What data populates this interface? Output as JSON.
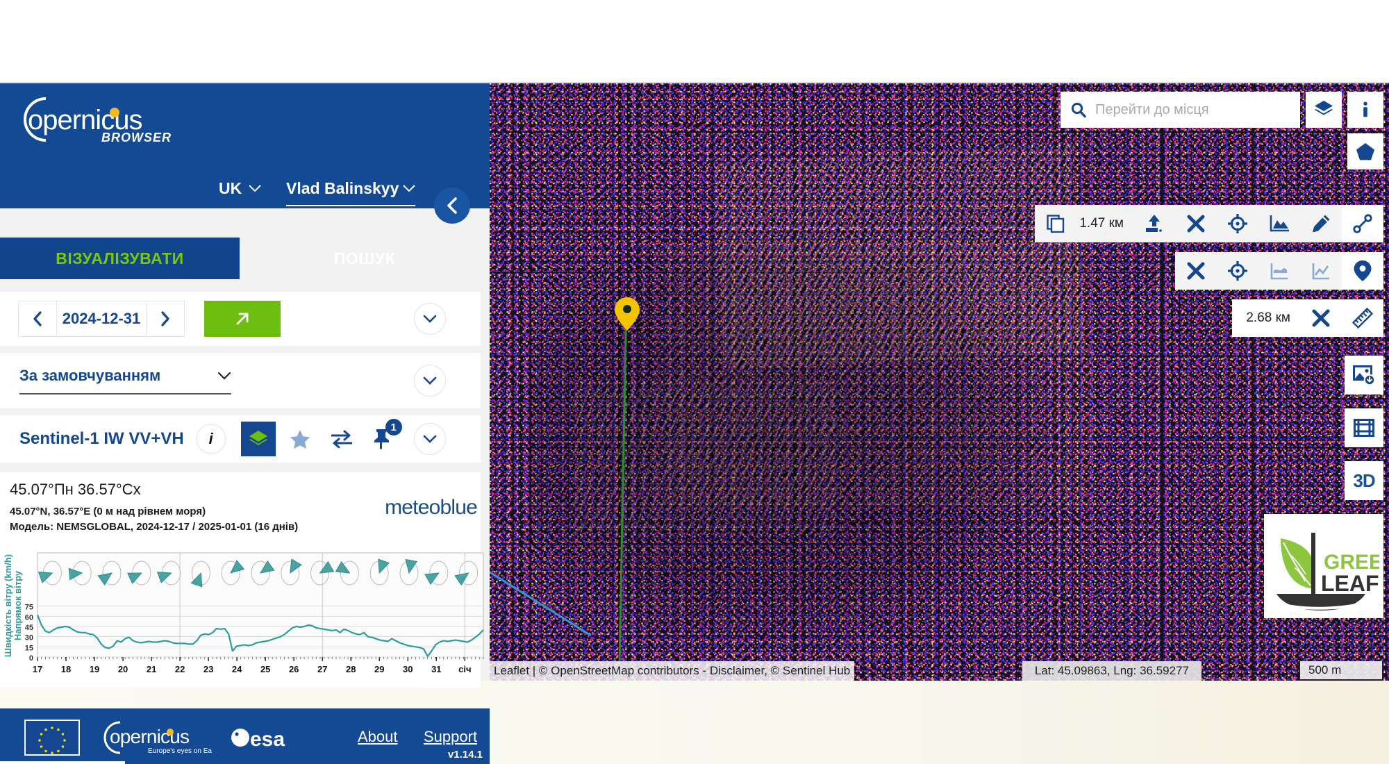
{
  "header": {
    "brand": "Copernicus",
    "brand_sub": "BROWSER",
    "language": "UK",
    "user": "Vlad Balinskyy",
    "collapse_icon": "chevron-left-icon"
  },
  "tabs": [
    {
      "label": "ВІЗУАЛІЗУВАТИ",
      "active": true
    },
    {
      "label": "ПОШУК",
      "active": false
    }
  ],
  "date_panel": {
    "prev_icon": "chevron-left-icon",
    "next_icon": "chevron-right-icon",
    "value": "2024-12-31",
    "go_icon": "arrow-up-right-icon",
    "expand_icon": "chevron-down-icon"
  },
  "preset_panel": {
    "value": "За замовчуванням",
    "dropdown_icon": "chevron-down-icon",
    "expand_icon": "chevron-down-icon"
  },
  "layer_panel": {
    "title": "Sentinel-1 IW VV+VH",
    "info_label": "i",
    "icons": [
      "layers-icon",
      "star-icon",
      "compare-icon",
      "pin-icon"
    ],
    "pin_badge": "1",
    "expand_icon": "chevron-down-icon"
  },
  "meteoblue": {
    "coordinates": "45.07°Пн 36.57°Сх",
    "subtitle_1": "45.07°N, 36.57°E (0 м над рівнем моря)",
    "subtitle_2": "Модель: NEMSGLOBAL, 2024-12-17 / 2025-01-01 (16 днів)",
    "brand": "meteoblue"
  },
  "chart_data": {
    "type": "line",
    "title": "",
    "xlabel": "",
    "ylabel": "Швидкість вітру (km/h)\nНапрямок вітру",
    "ylabel_line1": "Швидкість вітру (km/h)",
    "ylabel_line2": "Напрямок вітру",
    "ylim": [
      0,
      90
    ],
    "yticks": [
      0,
      15,
      30,
      45,
      60,
      75
    ],
    "xticks": [
      "17",
      "18",
      "19",
      "20",
      "21",
      "22",
      "23",
      "24",
      "25",
      "26",
      "27",
      "28",
      "29",
      "30",
      "31",
      "січ"
    ],
    "grid": true,
    "legend_position": "none",
    "series": [
      {
        "name": "Швидкість вітру (km/h)",
        "color": "#2a9d9d",
        "values": [
          62,
          47,
          38,
          36,
          40,
          43,
          44,
          45,
          44,
          40,
          37,
          36,
          36,
          34,
          33,
          28,
          19,
          14,
          13,
          16,
          24,
          22,
          27,
          29,
          24,
          22,
          21,
          22,
          23,
          22,
          22,
          23,
          24,
          23,
          21,
          20,
          20,
          20,
          19,
          19,
          24,
          32,
          34,
          33,
          36,
          42,
          41,
          42,
          34,
          9,
          16,
          17,
          18,
          17,
          18,
          21,
          22,
          23,
          24,
          26,
          28,
          30,
          33,
          38,
          43,
          45,
          44,
          45,
          47,
          46,
          43,
          42,
          41,
          40,
          39,
          40,
          36,
          41,
          39,
          36,
          34,
          33,
          36,
          30,
          29,
          27,
          25,
          24,
          23,
          27,
          24,
          21,
          19,
          17,
          16,
          15,
          14,
          12,
          1,
          9,
          18,
          22,
          24,
          23,
          24,
          25,
          24,
          23,
          22,
          25,
          29,
          34,
          40
        ]
      }
    ],
    "wind_arrows": [
      {
        "day": "17",
        "direction_deg": 250
      },
      {
        "day": "18",
        "direction_deg": 265
      },
      {
        "day": "19",
        "direction_deg": 235
      },
      {
        "day": "20",
        "direction_deg": 245
      },
      {
        "day": "21",
        "direction_deg": 250
      },
      {
        "day": "22",
        "direction_deg": 200
      },
      {
        "day": "23",
        "direction_deg": 50
      },
      {
        "day": "24",
        "direction_deg": 55
      },
      {
        "day": "25",
        "direction_deg": 30
      },
      {
        "day": "26",
        "direction_deg": 60
      },
      {
        "day": "27",
        "direction_deg": 300
      },
      {
        "day": "28",
        "direction_deg": 20
      },
      {
        "day": "29",
        "direction_deg": 10
      },
      {
        "day": "30",
        "direction_deg": 240
      },
      {
        "day": "31",
        "direction_deg": 235
      }
    ]
  },
  "footer": {
    "about": "About",
    "support": "Support",
    "version": "v1.14.1",
    "copernicus_tagline": "Europe's eyes on Earth",
    "esa": "esa"
  },
  "map": {
    "search_placeholder": "Перейти до місця",
    "search_value": "",
    "search_icon": "search-icon",
    "layers_icon": "layers-stack-icon",
    "info_icon": "info-icon",
    "polygon_icon": "pentagon-icon",
    "toolbar_draw": {
      "copy_icon": "copy-icon",
      "distance": "1.47 км",
      "upload_icon": "upload-icon",
      "close_icon": "close-icon",
      "crosshair_icon": "crosshair-icon",
      "terrain_icon": "terrain-icon",
      "pencil_icon": "pencil-icon",
      "line_icon": "line-measure-icon"
    },
    "toolbar_compare": {
      "close_icon": "close-icon",
      "crosshair_icon": "crosshair-icon",
      "area_chart_icon": "area-chart-icon",
      "line_chart_icon": "line-chart-icon",
      "marker_icon": "map-marker-icon"
    },
    "toolbar_measure": {
      "distance": "2.68 км",
      "close_icon": "close-icon",
      "ruler_icon": "ruler-icon"
    },
    "side_buttons": [
      {
        "name": "image-download-icon",
        "label": ""
      },
      {
        "name": "video-icon",
        "label": ""
      },
      {
        "name": "3d-button",
        "label": "3D"
      }
    ],
    "greenleaf": {
      "line1": "GREEN",
      "line2": "LEAF"
    },
    "attribution": "Leaflet | © OpenStreetMap contributors - Disclaimer, © Sentinel Hub",
    "coordinates": "Lat: 45.09863, Lng: 36.59277",
    "scale": "500 m",
    "marker_icon": "map-pin-marker"
  }
}
